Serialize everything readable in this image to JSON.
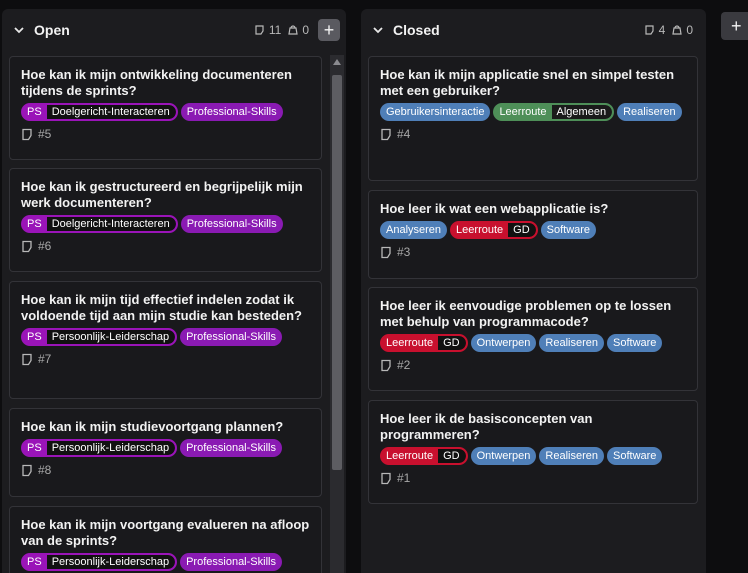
{
  "colors": {
    "ps": "#9a14b8",
    "professional": "#8a1ab3",
    "blue": "#4f7fb8",
    "green": "#4e8f58",
    "red": "#c8102e"
  },
  "columns": [
    {
      "title": "Open",
      "issues": "11",
      "weight": "0",
      "add": "+",
      "cards": [
        {
          "title": "Hoe kan ik mijn ontwikkeling documenteren tijdens de sprints?",
          "scoped_key": "PS",
          "scoped_val": "Doelgericht-Interacteren",
          "label": "Professional-Skills",
          "num": "#5"
        },
        {
          "title": "Hoe kan ik gestructureerd en begrijpelijk mijn werk documenteren?",
          "scoped_key": "PS",
          "scoped_val": "Doelgericht-Interacteren",
          "label": "Professional-Skills",
          "num": "#6"
        },
        {
          "title": "Hoe kan ik mijn tijd effectief indelen zodat ik voldoende tijd aan mijn studie kan besteden?",
          "scoped_key": "PS",
          "scoped_val": "Persoonlijk-Leiderschap",
          "label": "Professional-Skills",
          "num": "#7"
        },
        {
          "title": "Hoe kan ik mijn studievoortgang plannen?",
          "scoped_key": "PS",
          "scoped_val": "Persoonlijk-Leiderschap",
          "label": "Professional-Skills",
          "num": "#8"
        },
        {
          "title": "Hoe kan ik mijn voortgang evalueren na afloop van de sprints?",
          "scoped_key": "PS",
          "scoped_val": "Persoonlijk-Leiderschap",
          "label": "Professional-Skills",
          "num": ""
        }
      ]
    },
    {
      "title": "Closed",
      "issues": "4",
      "weight": "0",
      "cards": [
        {
          "title": "Hoe kan ik mijn applicatie snel en simpel testen met een gebruiker?",
          "num": "#4",
          "labels": [
            "Gebruikersinteractie",
            "Realiseren"
          ],
          "scoped_key": "Leerroute",
          "scoped_val": "Algemeen"
        },
        {
          "title": "Hoe leer ik wat een webapplicatie is?",
          "num": "#3",
          "labels": [
            "Analyseren",
            "Software"
          ],
          "scoped_key": "Leerroute",
          "scoped_val": "GD"
        },
        {
          "title": "Hoe leer ik eenvoudige problemen op te lossen met behulp van programmacode?",
          "num": "#2",
          "labels": [
            "Ontwerpen",
            "Realiseren",
            "Software"
          ],
          "scoped_key": "Leerroute",
          "scoped_val": "GD"
        },
        {
          "title": "Hoe leer ik de basisconcepten van programmeren?",
          "num": "#1",
          "labels": [
            "Ontwerpen",
            "Realiseren",
            "Software"
          ],
          "scoped_key": "Leerroute",
          "scoped_val": "GD"
        }
      ]
    }
  ],
  "new_column": "+",
  "icons": {
    "issues": "issue-icon",
    "weight": "weight-icon",
    "chevron": "chevron-down-icon",
    "card": "issue-card-icon"
  }
}
